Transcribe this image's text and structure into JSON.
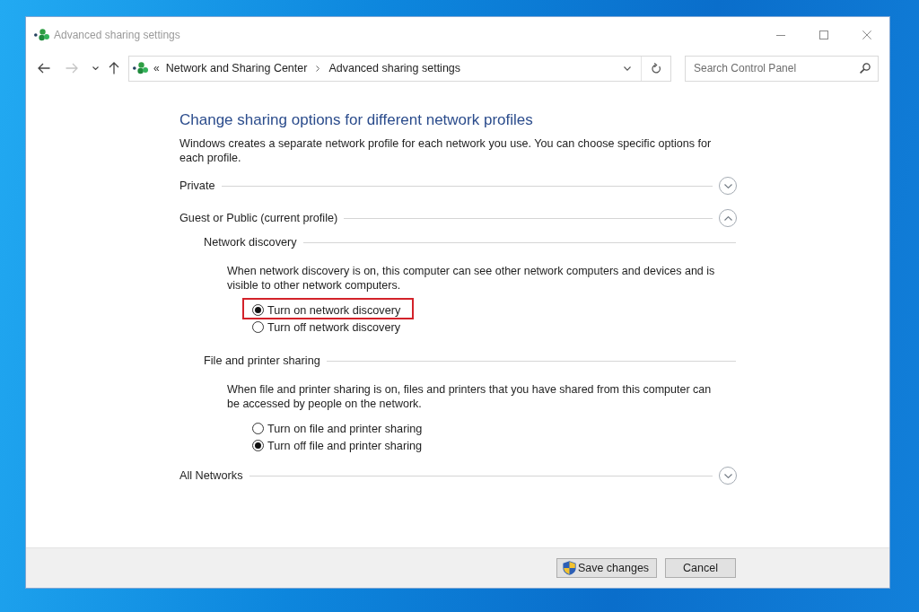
{
  "window": {
    "title": "Advanced sharing settings",
    "active": false
  },
  "navigation": [
    {
      "kind": "back",
      "disabled": false
    },
    {
      "kind": "forward",
      "disabled": true
    },
    {
      "kind": "recent",
      "disabled": false
    },
    {
      "kind": "up",
      "disabled": false
    }
  ],
  "address_bar": {
    "overflow": "«",
    "path": [
      "Network and Sharing Center",
      "Advanced sharing settings"
    ]
  },
  "search": {
    "placeholder": "Search Control Panel"
  },
  "heading": "Change sharing options for different network profiles",
  "intro": "Windows creates a separate network profile for each network you use. You can choose specific options for each profile.",
  "profiles": [
    {
      "name": "Private",
      "expanded": false
    },
    {
      "name": "Guest or Public (current profile)",
      "expanded": true,
      "sections": [
        {
          "title": "Network discovery",
          "description": "When network discovery is on, this computer can see other network computers and devices and is visible to other network computers.",
          "options": [
            {
              "label": "Turn on network discovery",
              "selected": true,
              "highlighted": true
            },
            {
              "label": "Turn off network discovery",
              "selected": false,
              "highlighted": false
            }
          ]
        },
        {
          "title": "File and printer sharing",
          "description": "When file and printer sharing is on, files and printers that you have shared from this computer can be accessed by people on the network.",
          "options": [
            {
              "label": "Turn on file and printer sharing",
              "selected": false,
              "highlighted": false
            },
            {
              "label": "Turn off file and printer sharing",
              "selected": true,
              "highlighted": false
            }
          ]
        }
      ]
    },
    {
      "name": "All Networks",
      "expanded": false
    }
  ],
  "buttons": [
    {
      "label": "Save changes",
      "kind": "shield"
    },
    {
      "label": "Cancel",
      "kind": "plain"
    }
  ]
}
